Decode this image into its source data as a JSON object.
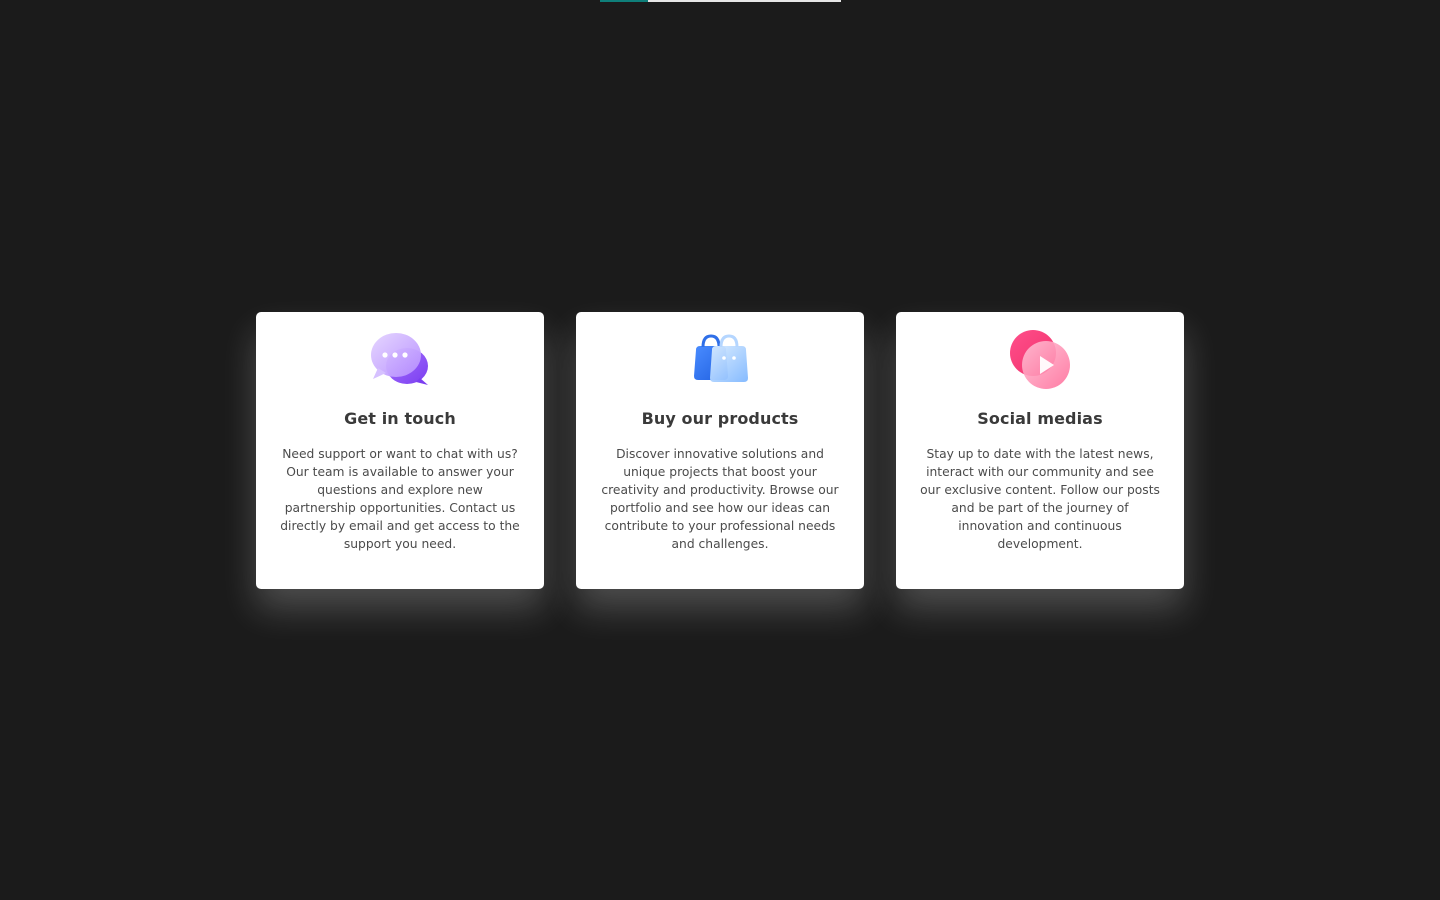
{
  "colors": {
    "background": "#1b1b1b",
    "card_background": "#ffffff",
    "title": "#3a3a3a",
    "text": "#4b4b4b",
    "progress_accent": "#0f7f7a"
  },
  "progress": {
    "fraction": 0.2
  },
  "cards": [
    {
      "icon": "chat-bubbles-icon",
      "title": "Get in touch",
      "description": "Need support or want to chat with us? Our team is available to answer your questions and explore new partnership opportunities. Contact us directly by email and get access to the support you need."
    },
    {
      "icon": "shopping-bags-icon",
      "title": "Buy our products",
      "description": "Discover innovative solutions and unique projects that boost your creativity and productivity. Browse our portfolio and see how our ideas can contribute to your professional needs and challenges."
    },
    {
      "icon": "play-button-icon",
      "title": "Social medias",
      "description": "Stay up to date with the latest news, interact with our community and see our exclusive content. Follow our posts and be part of the journey of innovation and continuous development."
    }
  ]
}
